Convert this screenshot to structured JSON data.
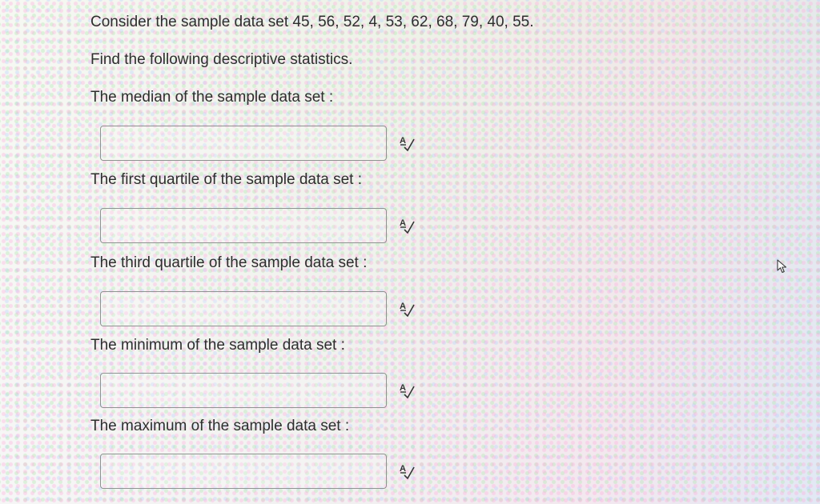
{
  "question": {
    "prompt": "Consider the sample data set 45, 56, 52, 4, 53, 62, 68, 79, 40, 55.",
    "instruction": "Find the following descriptive statistics."
  },
  "fields": [
    {
      "label": "The median of the sample data set :",
      "value": "",
      "icon": "spellcheck-icon"
    },
    {
      "label": "The first quartile of the sample data set :",
      "value": "",
      "icon": "spellcheck-icon"
    },
    {
      "label": "The third quartile of the sample data set :",
      "value": "",
      "icon": "spellcheck-icon"
    },
    {
      "label": "The minimum of the sample data set :",
      "value": "",
      "icon": "spellcheck-icon"
    },
    {
      "label": "The maximum of the sample data set :",
      "value": "",
      "icon": "spellcheck-icon"
    }
  ],
  "pointer": {
    "icon": "mouse-pointer-icon"
  }
}
